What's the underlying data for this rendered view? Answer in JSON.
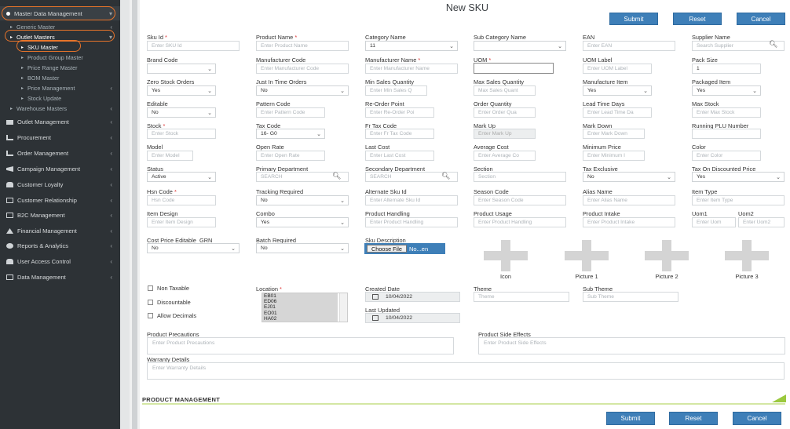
{
  "sidebar": {
    "master_data": "Master Data Management",
    "generic": "Generic Master",
    "outlet": "Outlet Masters",
    "sku": "SKU Master",
    "product_group": "Product Group Master",
    "price_range": "Price Range Master",
    "bom": "BOM Master",
    "price_mgmt": "Price Management",
    "stock_update": "Stock Update",
    "warehouse": "Warehouse Masters",
    "outlet_mgmt": "Outlet Management",
    "procurement": "Procurement",
    "order_mgmt": "Order Management",
    "campaign": "Campaign Management",
    "loyalty": "Customer Loyalty",
    "crm": "Customer Relationship",
    "b2c": "B2C Management",
    "financial": "Financial Management",
    "reports": "Reports & Analytics",
    "access": "User Access Control",
    "data_mgmt": "Data Management"
  },
  "title": "New SKU",
  "buttons": {
    "submit": "Submit",
    "reset": "Reset",
    "cancel": "Cancel"
  },
  "fields": {
    "sku_id": {
      "label": "Sku Id",
      "placeholder": "Enter SKU Id"
    },
    "product_name": {
      "label": "Product Name",
      "placeholder": "Enter Product Name"
    },
    "category_name": {
      "label": "Category Name",
      "value": "11"
    },
    "sub_category_name": {
      "label": "Sub Category Name",
      "value": ""
    },
    "ean": {
      "label": "EAN",
      "placeholder": "Enter EAN"
    },
    "supplier_name": {
      "label": "Supplier Name",
      "placeholder": "Search Supplier"
    },
    "brand_code": {
      "label": "Brand Code",
      "value": ""
    },
    "manufacturer_code": {
      "label": "Manufacturer Code",
      "placeholder": "Enter Manufacturer Code"
    },
    "manufacturer_name": {
      "label": "Manufacturer Name",
      "placeholder": "Enter Manufacturer Name"
    },
    "uom": {
      "label": "UOM",
      "value": ""
    },
    "uom_label": {
      "label": "UOM Label",
      "placeholder": "Enter UOM Label"
    },
    "pack_size": {
      "label": "Pack Size",
      "value": "1"
    },
    "zero_stock": {
      "label": "Zero Stock Orders",
      "value": "Yes"
    },
    "just_in_time": {
      "label": "Just In Time Orders",
      "value": "No"
    },
    "min_sales_qty": {
      "label": "Min Sales Quantity",
      "placeholder": "Enter Min Sales Q"
    },
    "max_sales_qty": {
      "label": "Max Sales Quantity",
      "placeholder": "Max Sales Quant"
    },
    "manufacture_item": {
      "label": "Manufacture Item",
      "value": "Yes"
    },
    "packaged_item": {
      "label": "Packaged Item",
      "value": "Yes"
    },
    "editable": {
      "label": "Editable",
      "value": "No"
    },
    "pattern_code": {
      "label": "Pattern Code",
      "placeholder": "Enter Pattern Code"
    },
    "reorder_point": {
      "label": "Re-Order Point",
      "placeholder": "Enter Re-Order Poi"
    },
    "order_quantity": {
      "label": "Order Quantity",
      "placeholder": "Enter Order Qua"
    },
    "lead_time": {
      "label": "Lead Time Days",
      "placeholder": "Enter Lead Time Da"
    },
    "max_stock": {
      "label": "Max Stock",
      "placeholder": "Enter Max Stock"
    },
    "stock": {
      "label": "Stock",
      "placeholder": "Enter Stock"
    },
    "tax_code": {
      "label": "Tax Code",
      "value": "16- G0"
    },
    "fr_tax_code": {
      "label": "Fr Tax Code",
      "placeholder": "Enter Fr Tax Code"
    },
    "mark_up": {
      "label": "Mark Up",
      "placeholder": "Enter Mark Up"
    },
    "mark_down": {
      "label": "Mark Down",
      "placeholder": "Enter Mark Down"
    },
    "running_plu": {
      "label": "Running PLU Number",
      "value": ""
    },
    "model": {
      "label": "Model",
      "placeholder": "Enter Model"
    },
    "open_rate": {
      "label": "Open Rate",
      "placeholder": "Enter Open Rate"
    },
    "last_cost": {
      "label": "Last Cost",
      "placeholder": "Enter Last Cost"
    },
    "average_cost": {
      "label": "Average Cost",
      "placeholder": "Enter Average Co"
    },
    "minimum_price": {
      "label": "Minimum Price",
      "placeholder": "Enter Minimum I"
    },
    "color": {
      "label": "Color",
      "placeholder": "Enter Color"
    },
    "status": {
      "label": "Status",
      "value": "Active"
    },
    "primary_dept": {
      "label": "Primary Department",
      "placeholder": "SEARCH"
    },
    "secondary_dept": {
      "label": "Secondary Department",
      "placeholder": "SEARCH"
    },
    "section": {
      "label": "Section",
      "placeholder": "Section"
    },
    "tax_exclusive": {
      "label": "Tax Exclusive",
      "value": "No"
    },
    "tax_on_discounted": {
      "label": "Tax On Discounted Price",
      "value": "Yes"
    },
    "hsn_code": {
      "label": "Hsn Code",
      "placeholder": "Hsn Code"
    },
    "tracking_required": {
      "label": "Tracking Required",
      "value": "No"
    },
    "alternate_sku": {
      "label": "Alternate Sku Id",
      "placeholder": "Enter Alternate Sku Id"
    },
    "season_code": {
      "label": "Season Code",
      "placeholder": "Enter Season Code"
    },
    "alias_name": {
      "label": "Alias Name",
      "placeholder": "Enter Alias Name"
    },
    "item_type": {
      "label": "Item Type",
      "placeholder": "Enter Item Type"
    },
    "item_design": {
      "label": "Item Design",
      "placeholder": "Enter Item Design"
    },
    "combo": {
      "label": "Combo",
      "value": "Yes"
    },
    "product_handling": {
      "label": "Product Handling",
      "placeholder": "Enter Product Handling"
    },
    "product_usage": {
      "label": "Product Usage",
      "placeholder": "Enter Product Handling"
    },
    "product_intake": {
      "label": "Product Intake",
      "placeholder": "Enter Product Intake"
    },
    "uom1": {
      "label": "Uom1",
      "placeholder": "Enter Uom"
    },
    "uom2": {
      "label": "Uom2",
      "placeholder": "Enter Uom2"
    },
    "cost_price_editable": {
      "label": "Cost Price Editable_GRN",
      "value": "No"
    },
    "batch_required": {
      "label": "Batch Required",
      "value": "No"
    },
    "sku_description": {
      "label": "Sku Description",
      "button": "Choose File",
      "filename": "No...en"
    },
    "location": {
      "label": "Location",
      "options": [
        "EB01",
        "ED06",
        "EJ01",
        "EO01",
        "HA02"
      ]
    },
    "created_date": {
      "label": "Created Date",
      "value": "10/04/2022"
    },
    "last_updated": {
      "label": "Last Updated",
      "value": "10/04/2022"
    },
    "theme": {
      "label": "Theme",
      "placeholder": "Theme"
    },
    "sub_theme": {
      "label": "Sub Theme",
      "placeholder": "Sub Theme"
    },
    "product_precautions": {
      "label": "Product Precautions",
      "placeholder": "Enter Product Precautions"
    },
    "product_side_effects": {
      "label": "Product Side Effects",
      "placeholder": "Enter Product Side Effects"
    },
    "warranty_details": {
      "label": "Warranty Details",
      "placeholder": "Enter Warranty Details"
    }
  },
  "checkboxes": {
    "non_taxable": "Non Taxable",
    "discountable": "Discountable",
    "allow_decimals": "Allow Decimals"
  },
  "images": {
    "icon": "Icon",
    "picture1": "Picture 1",
    "picture2": "Picture 2",
    "picture3": "Picture 3"
  },
  "product_management": "PRODUCT MANAGEMENT",
  "colors": {
    "sidebar": "#2d3236",
    "accent": "#3e7fb8",
    "highlight": "#e8742a",
    "section_line": "#9bc93e"
  }
}
